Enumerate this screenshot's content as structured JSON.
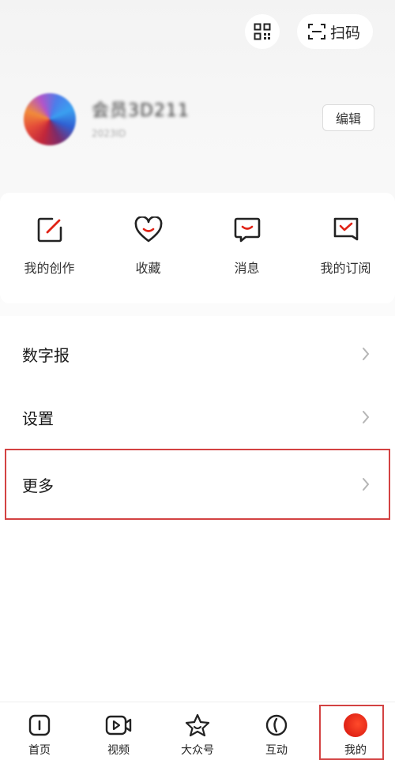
{
  "topbar": {
    "qr_icon": "qr-code-icon",
    "scan_icon": "scan-icon",
    "scan_label": "扫码"
  },
  "profile": {
    "username": "会员3D211",
    "subline": "2023ID",
    "edit_label": "编辑"
  },
  "quick_actions": [
    {
      "label": "我的创作",
      "icon": "edit-icon"
    },
    {
      "label": "收藏",
      "icon": "heart-icon"
    },
    {
      "label": "消息",
      "icon": "message-icon"
    },
    {
      "label": "我的订阅",
      "icon": "subscribe-icon"
    }
  ],
  "menu": [
    {
      "label": "数字报"
    },
    {
      "label": "设置"
    },
    {
      "label": "更多"
    }
  ],
  "tabbar": [
    {
      "label": "首页",
      "icon": "home-icon"
    },
    {
      "label": "视频",
      "icon": "video-icon"
    },
    {
      "label": "大众号",
      "icon": "star-icon"
    },
    {
      "label": "互动",
      "icon": "interact-icon"
    },
    {
      "label": "我的",
      "icon": "me-icon",
      "active": true
    }
  ],
  "colors": {
    "accent": "#e02316",
    "highlight_box": "#d34242"
  }
}
